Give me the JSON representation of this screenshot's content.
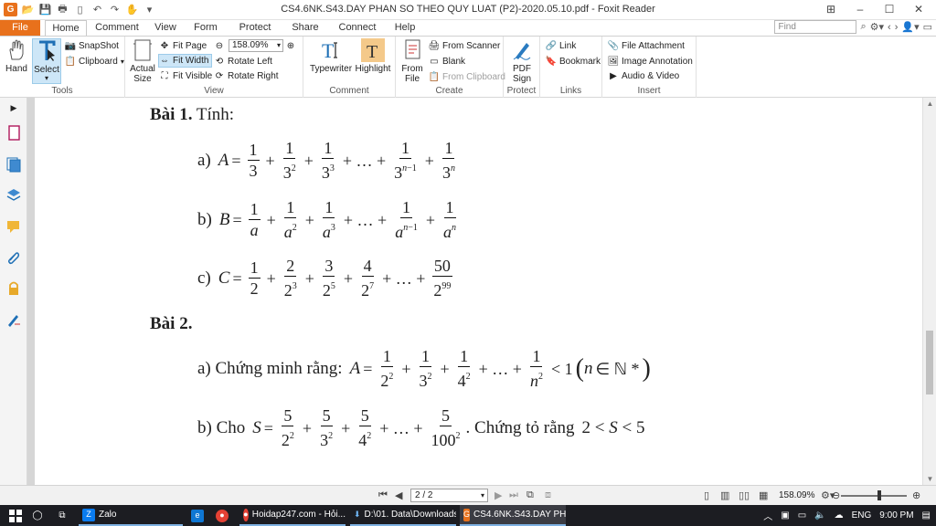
{
  "window": {
    "title": "CS4.6NK.S43.DAY PHAN SO THEO QUY LUAT (P2)-2020.05.10.pdf - Foxit Reader"
  },
  "tabs": [
    {
      "label": "File"
    },
    {
      "label": "Home"
    },
    {
      "label": "Comment"
    },
    {
      "label": "View"
    },
    {
      "label": "Form"
    },
    {
      "label": "Protect"
    },
    {
      "label": "Share"
    },
    {
      "label": "Connect"
    },
    {
      "label": "Help"
    }
  ],
  "search": {
    "placeholder": "Find"
  },
  "ribbon": {
    "tools": {
      "label": "Tools",
      "hand": "Hand",
      "select": "Select",
      "snapshot": "SnapShot",
      "clipboard": "Clipboard"
    },
    "view": {
      "label": "View",
      "actual_size_1": "Actual",
      "actual_size_2": "Size",
      "fit_page": "Fit Page",
      "fit_width": "Fit Width",
      "fit_visible": "Fit Visible",
      "zoom": "158.09%",
      "rotate_left": "Rotate Left",
      "rotate_right": "Rotate Right"
    },
    "comment": {
      "label": "Comment",
      "typewriter": "Typewriter",
      "highlight": "Highlight"
    },
    "create": {
      "label": "Create",
      "from_file_1": "From",
      "from_file_2": "File",
      "from_scanner": "From Scanner",
      "blank": "Blank",
      "from_clipboard": "From Clipboard"
    },
    "protect": {
      "label": "Protect",
      "pdf_sign_1": "PDF",
      "pdf_sign_2": "Sign"
    },
    "links": {
      "label": "Links",
      "link": "Link",
      "bookmark": "Bookmark"
    },
    "insert": {
      "label": "Insert",
      "file_attachment": "File Attachment",
      "image_annotation": "Image Annotation",
      "audio_video": "Audio & Video"
    }
  },
  "document": {
    "bai1": {
      "bold": "Bài 1.",
      "rest": " Tính:"
    },
    "bai2": {
      "bold": "Bài 2."
    },
    "a_label": "a)",
    "b_label": "b)",
    "c_label": "c)",
    "b2a_text": "a) Chứng minh rằng:",
    "b2b_text": "b) Cho",
    "b2b_tail": ". Chứng tỏ rằng"
  },
  "status": {
    "page": "2 / 2",
    "zoom": "158.09%"
  },
  "taskbar": {
    "zalo": "Zalo",
    "hoidap": "Hoidap247.com - Hỏi...",
    "downloads": "D:\\01. Data\\Downloads",
    "foxit": "CS4.6NK.S43.DAY PH...",
    "lang": "ENG",
    "time": "9:00 PM"
  },
  "colors": {
    "file_tab": "#e8711c",
    "selected": "#cde6f7",
    "taskbar": "#1c1d22"
  }
}
